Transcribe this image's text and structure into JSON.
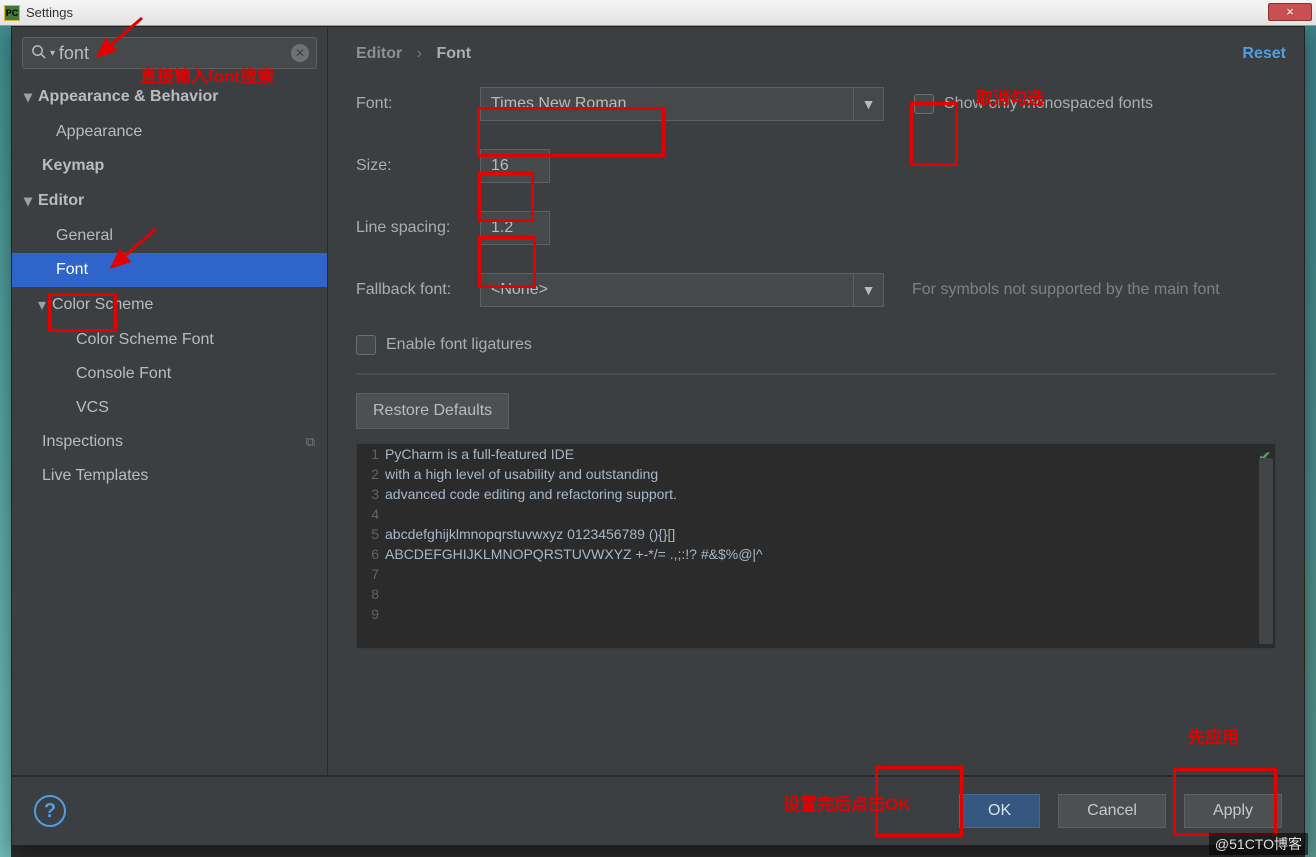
{
  "window": {
    "title": "Settings",
    "close": "×",
    "app_badge": "PC"
  },
  "search": {
    "value": "font"
  },
  "annotations": {
    "search_hint": "直接输入font搜索",
    "uncheck_hint": "取消勾选",
    "apply_hint": "先应用",
    "ok_hint": "设置完后点击OK"
  },
  "tree": {
    "appearance_behavior": "Appearance & Behavior",
    "appearance": "Appearance",
    "keymap": "Keymap",
    "editor": "Editor",
    "general": "General",
    "font": "Font",
    "color_scheme": "Color Scheme",
    "color_scheme_font": "Color Scheme Font",
    "console_font": "Console Font",
    "vcs": "VCS",
    "inspections": "Inspections",
    "live_templates": "Live Templates"
  },
  "breadcrumb": {
    "a": "Editor",
    "b": "Font"
  },
  "reset": "Reset",
  "form": {
    "font_label": "Font:",
    "font_value": "Times New Roman",
    "show_mono": "Show only monospaced fonts",
    "size_label": "Size:",
    "size_value": "16",
    "spacing_label": "Line spacing:",
    "spacing_value": "1.2",
    "fallback_label": "Fallback font:",
    "fallback_value": "<None>",
    "fallback_hint": "For symbols not supported by the main font",
    "ligatures": "Enable font ligatures",
    "restore": "Restore Defaults"
  },
  "preview": [
    "PyCharm is a full-featured IDE",
    "with a high level of usability and outstanding",
    "advanced code editing and refactoring support.",
    "",
    "abcdefghijklmnopqrstuvwxyz 0123456789 (){}[]",
    "ABCDEFGHIJKLMNOPQRSTUVWXYZ +-*/= .,;:!? #&$%@|^",
    "",
    "",
    ""
  ],
  "buttons": {
    "ok": "OK",
    "cancel": "Cancel",
    "apply": "Apply"
  },
  "watermark": "@51CTO博客"
}
